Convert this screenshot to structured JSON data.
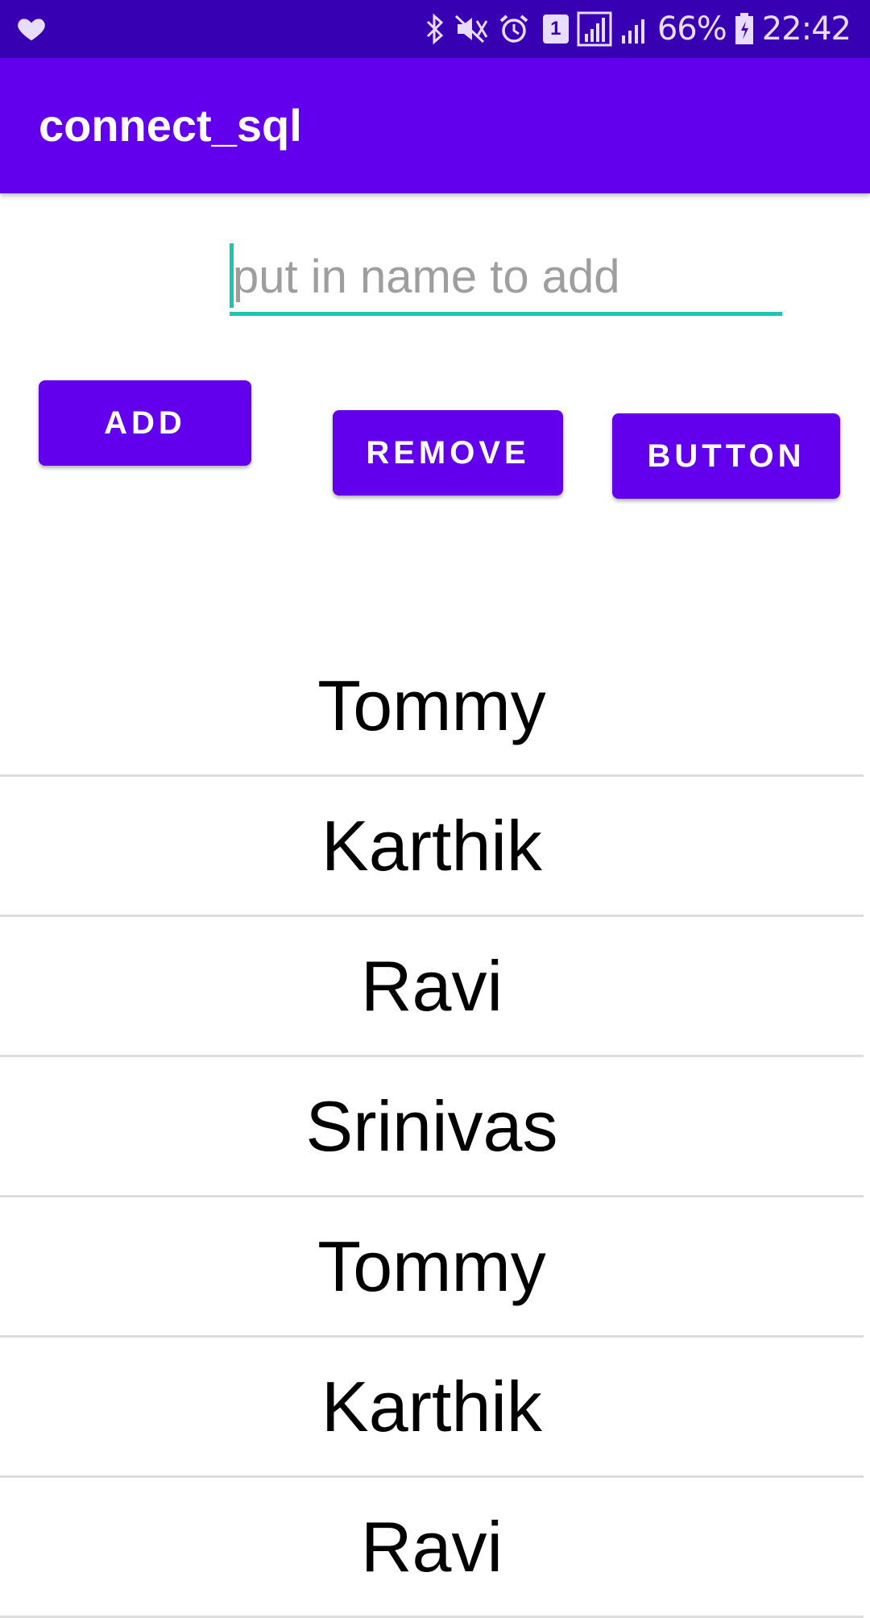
{
  "status_bar": {
    "battery": "66%",
    "time": "22:42",
    "sim_badge": "1",
    "icons": [
      "heart-icon",
      "bluetooth-icon",
      "mute-icon",
      "alarm-icon",
      "sim-icon",
      "signal-icon",
      "signal-icon-2",
      "battery-icon"
    ]
  },
  "app_bar": {
    "title": "connect_sql",
    "color": "#6200ee"
  },
  "input": {
    "placeholder": "put in name to add",
    "value": "",
    "accent": "#1bc5b5"
  },
  "buttons": {
    "add": "ADD",
    "remove": "REMOVE",
    "button": "BUTTON"
  },
  "list": {
    "items": [
      "Tommy",
      "Karthik",
      "Ravi",
      "Srinivas",
      "Tommy",
      "Karthik",
      "Ravi"
    ]
  }
}
